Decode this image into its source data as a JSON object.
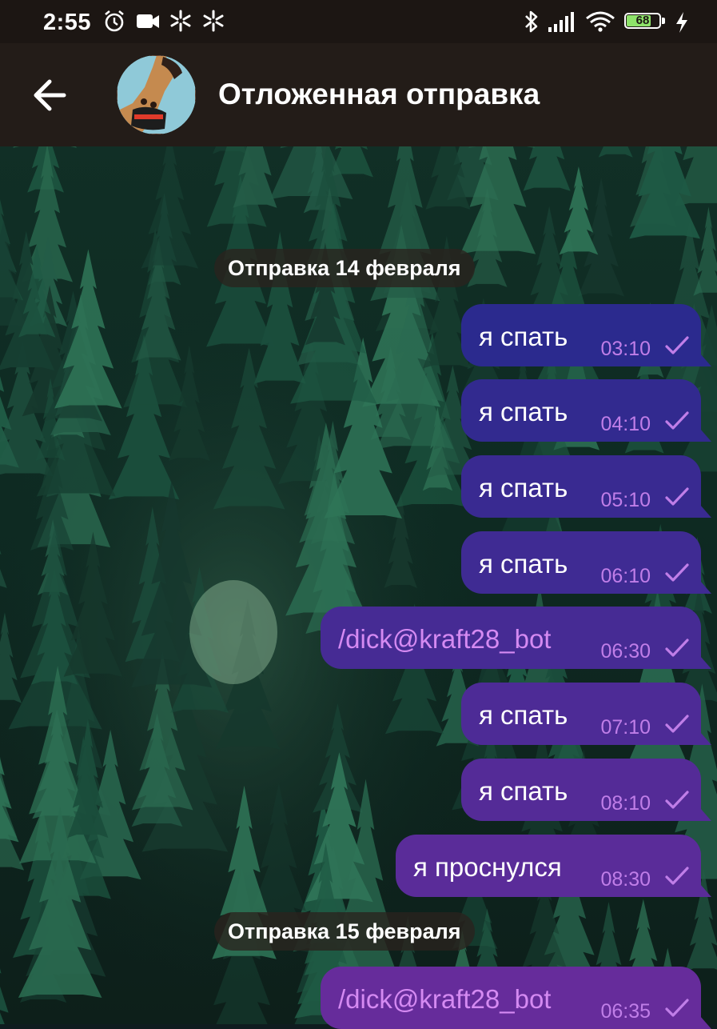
{
  "status_bar": {
    "time": "2:55",
    "battery": "68",
    "left_icons": [
      "alarm-icon",
      "video-camera-icon",
      "sparkle-icon",
      "sparkle-icon"
    ],
    "right_icons": [
      "bluetooth-icon",
      "cellular-signal-icon",
      "wifi-icon",
      "battery-icon",
      "charging-icon"
    ]
  },
  "header": {
    "back_icon": "arrow-left-icon",
    "title": "Отложенная отправка"
  },
  "colors": {
    "header_bg": "#231c18",
    "status_bg": "#1c1613",
    "chip_bg": "#2a221e",
    "bubble_gradient_top": "#2b2a8e",
    "bubble_gradient_bottom": "#6a2c9c",
    "meta_color": "#c07ee8",
    "command_text": "#d58af2"
  },
  "chat": {
    "date_chips": [
      {
        "label": "Отправка 14 февраля"
      },
      {
        "label": "Отправка 15 февраля"
      }
    ],
    "messages": [
      {
        "text": "я спать",
        "time": "03:10",
        "is_command": false,
        "status": "check-icon"
      },
      {
        "text": "я спать",
        "time": "04:10",
        "is_command": false,
        "status": "check-icon"
      },
      {
        "text": "я спать",
        "time": "05:10",
        "is_command": false,
        "status": "check-icon"
      },
      {
        "text": "я спать",
        "time": "06:10",
        "is_command": false,
        "status": "check-icon"
      },
      {
        "text": "/dick@kraft28_bot",
        "time": "06:30",
        "is_command": true,
        "status": "check-icon"
      },
      {
        "text": "я спать",
        "time": "07:10",
        "is_command": false,
        "status": "check-icon"
      },
      {
        "text": "я спать",
        "time": "08:10",
        "is_command": false,
        "status": "check-icon"
      },
      {
        "text": "я проснулся",
        "time": "08:30",
        "is_command": false,
        "status": "check-icon"
      },
      {
        "text": "/dick@kraft28_bot",
        "time": "06:35",
        "is_command": true,
        "status": "check-icon"
      }
    ]
  }
}
